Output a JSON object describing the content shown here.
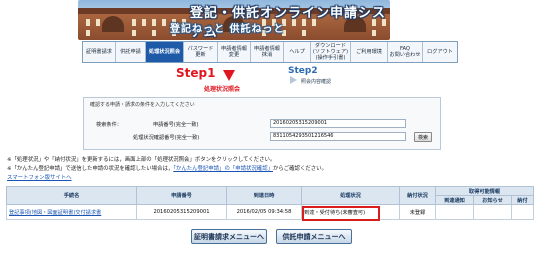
{
  "header": {
    "title": "登記・供託オンライン申請システム",
    "subtitle": "登記ねっと 供託ねっと"
  },
  "nav": {
    "items": [
      {
        "label": "証明書請求"
      },
      {
        "label": "供託申請"
      },
      {
        "label": "処理状況照会"
      },
      {
        "label": "パスワード\n更新"
      },
      {
        "label": "申請者情報\n変更"
      },
      {
        "label": "申請者情報\n抹消"
      },
      {
        "label": "ヘルプ"
      },
      {
        "label": "ダウンロード\n(ソフトウェア)\n(操作手引書)"
      },
      {
        "label": "ご利用環境"
      },
      {
        "label": "FAQ\nお問い合わせ"
      },
      {
        "label": "ログアウト"
      }
    ]
  },
  "steps": {
    "step1": "Step1",
    "step1_label": "処理状況照会",
    "step2": "Step2",
    "step2_label": "照会内容確認"
  },
  "search": {
    "header": "確認する申請・請求の条件を入力してください",
    "conditions_label": "検索条件：",
    "app_number_label": "申請番号(完全一致)",
    "app_number_value": "20160205315209001",
    "tracking_label": "処理状況確認番号(完全一致)",
    "tracking_value": "8311054293501216546",
    "search_button": "検索"
  },
  "notes": {
    "line1": "※「処理状況」や「納付状況」を更新するには，画面上部の「処理状況照会」ボタンをクリックしてください。",
    "line2_before": "※「かんたん登記申請」で送信した申請の状況を確認したい場合は，",
    "line2_link": "「かんたん登記申請」の「申請状況確認」",
    "line2_after": "からご確認ください。",
    "smartphone_link": "スマートフォン版サイトへ"
  },
  "table": {
    "headers": {
      "name": "手続名",
      "app_number": "申請番号",
      "datetime": "到達日時",
      "status": "処理状況",
      "payment": "納付状況",
      "retrieval": "取得可能情報",
      "arrival": "到達通知",
      "notice": "お知らせ",
      "pay": "納付"
    },
    "rows": [
      {
        "name": "登記事項(地図・図面証明書)交付請求書",
        "app_number": "20160205315209001",
        "datetime": "2016/02/05 09:34:58",
        "status": "到達・受付待ち(未審査可)",
        "payment": "未登録",
        "arrival": "",
        "notice": "",
        "pay": ""
      }
    ]
  },
  "buttons": {
    "cert_menu": "証明書請求メニューへ",
    "deposit_menu": "供託申請メニューへ"
  }
}
